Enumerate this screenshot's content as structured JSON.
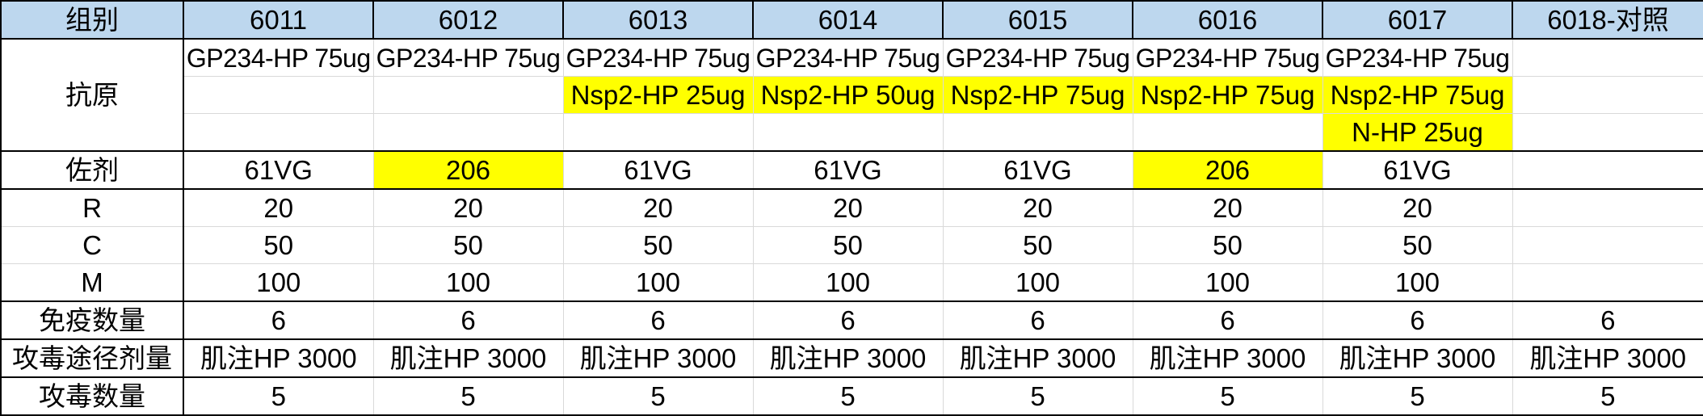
{
  "header": {
    "label": "组别",
    "groups": [
      "6011",
      "6012",
      "6013",
      "6014",
      "6015",
      "6016",
      "6017",
      "6018-对照"
    ]
  },
  "antigen": {
    "label": "抗原",
    "row1": [
      "GP234-HP 75ug",
      "GP234-HP 75ug",
      "GP234-HP 75ug",
      "GP234-HP 75ug",
      "GP234-HP 75ug",
      "GP234-HP 75ug",
      "GP234-HP 75ug",
      ""
    ],
    "row2": [
      "",
      "",
      "Nsp2-HP 25ug",
      "Nsp2-HP 50ug",
      "Nsp2-HP 75ug",
      "Nsp2-HP 75ug",
      "Nsp2-HP 75ug",
      ""
    ],
    "row3": [
      "",
      "",
      "",
      "",
      "",
      "",
      "N-HP 25ug",
      ""
    ]
  },
  "adjuvant": {
    "label": "佐剂",
    "values": [
      "61VG",
      "206",
      "61VG",
      "61VG",
      "61VG",
      "206",
      "61VG",
      ""
    ]
  },
  "r": {
    "label": "R",
    "values": [
      "20",
      "20",
      "20",
      "20",
      "20",
      "20",
      "20",
      ""
    ]
  },
  "c": {
    "label": "C",
    "values": [
      "50",
      "50",
      "50",
      "50",
      "50",
      "50",
      "50",
      ""
    ]
  },
  "m": {
    "label": "M",
    "values": [
      "100",
      "100",
      "100",
      "100",
      "100",
      "100",
      "100",
      ""
    ]
  },
  "immune_count": {
    "label": "免疫数量",
    "values": [
      "6",
      "6",
      "6",
      "6",
      "6",
      "6",
      "6",
      "6"
    ]
  },
  "challenge_route_dose": {
    "label": "攻毒途径剂量",
    "values": [
      "肌注HP 3000",
      "肌注HP 3000",
      "肌注HP 3000",
      "肌注HP 3000",
      "肌注HP 3000",
      "肌注HP 3000",
      "肌注HP 3000",
      "肌注HP 3000"
    ]
  },
  "challenge_count": {
    "label": "攻毒数量",
    "values": [
      "5",
      "5",
      "5",
      "5",
      "5",
      "5",
      "5",
      "5"
    ]
  },
  "colors": {
    "header_fill": "#bdd7ee",
    "highlight_fill": "#ffff00",
    "grid_line": "#d9d9d9",
    "border_line": "#000000"
  }
}
